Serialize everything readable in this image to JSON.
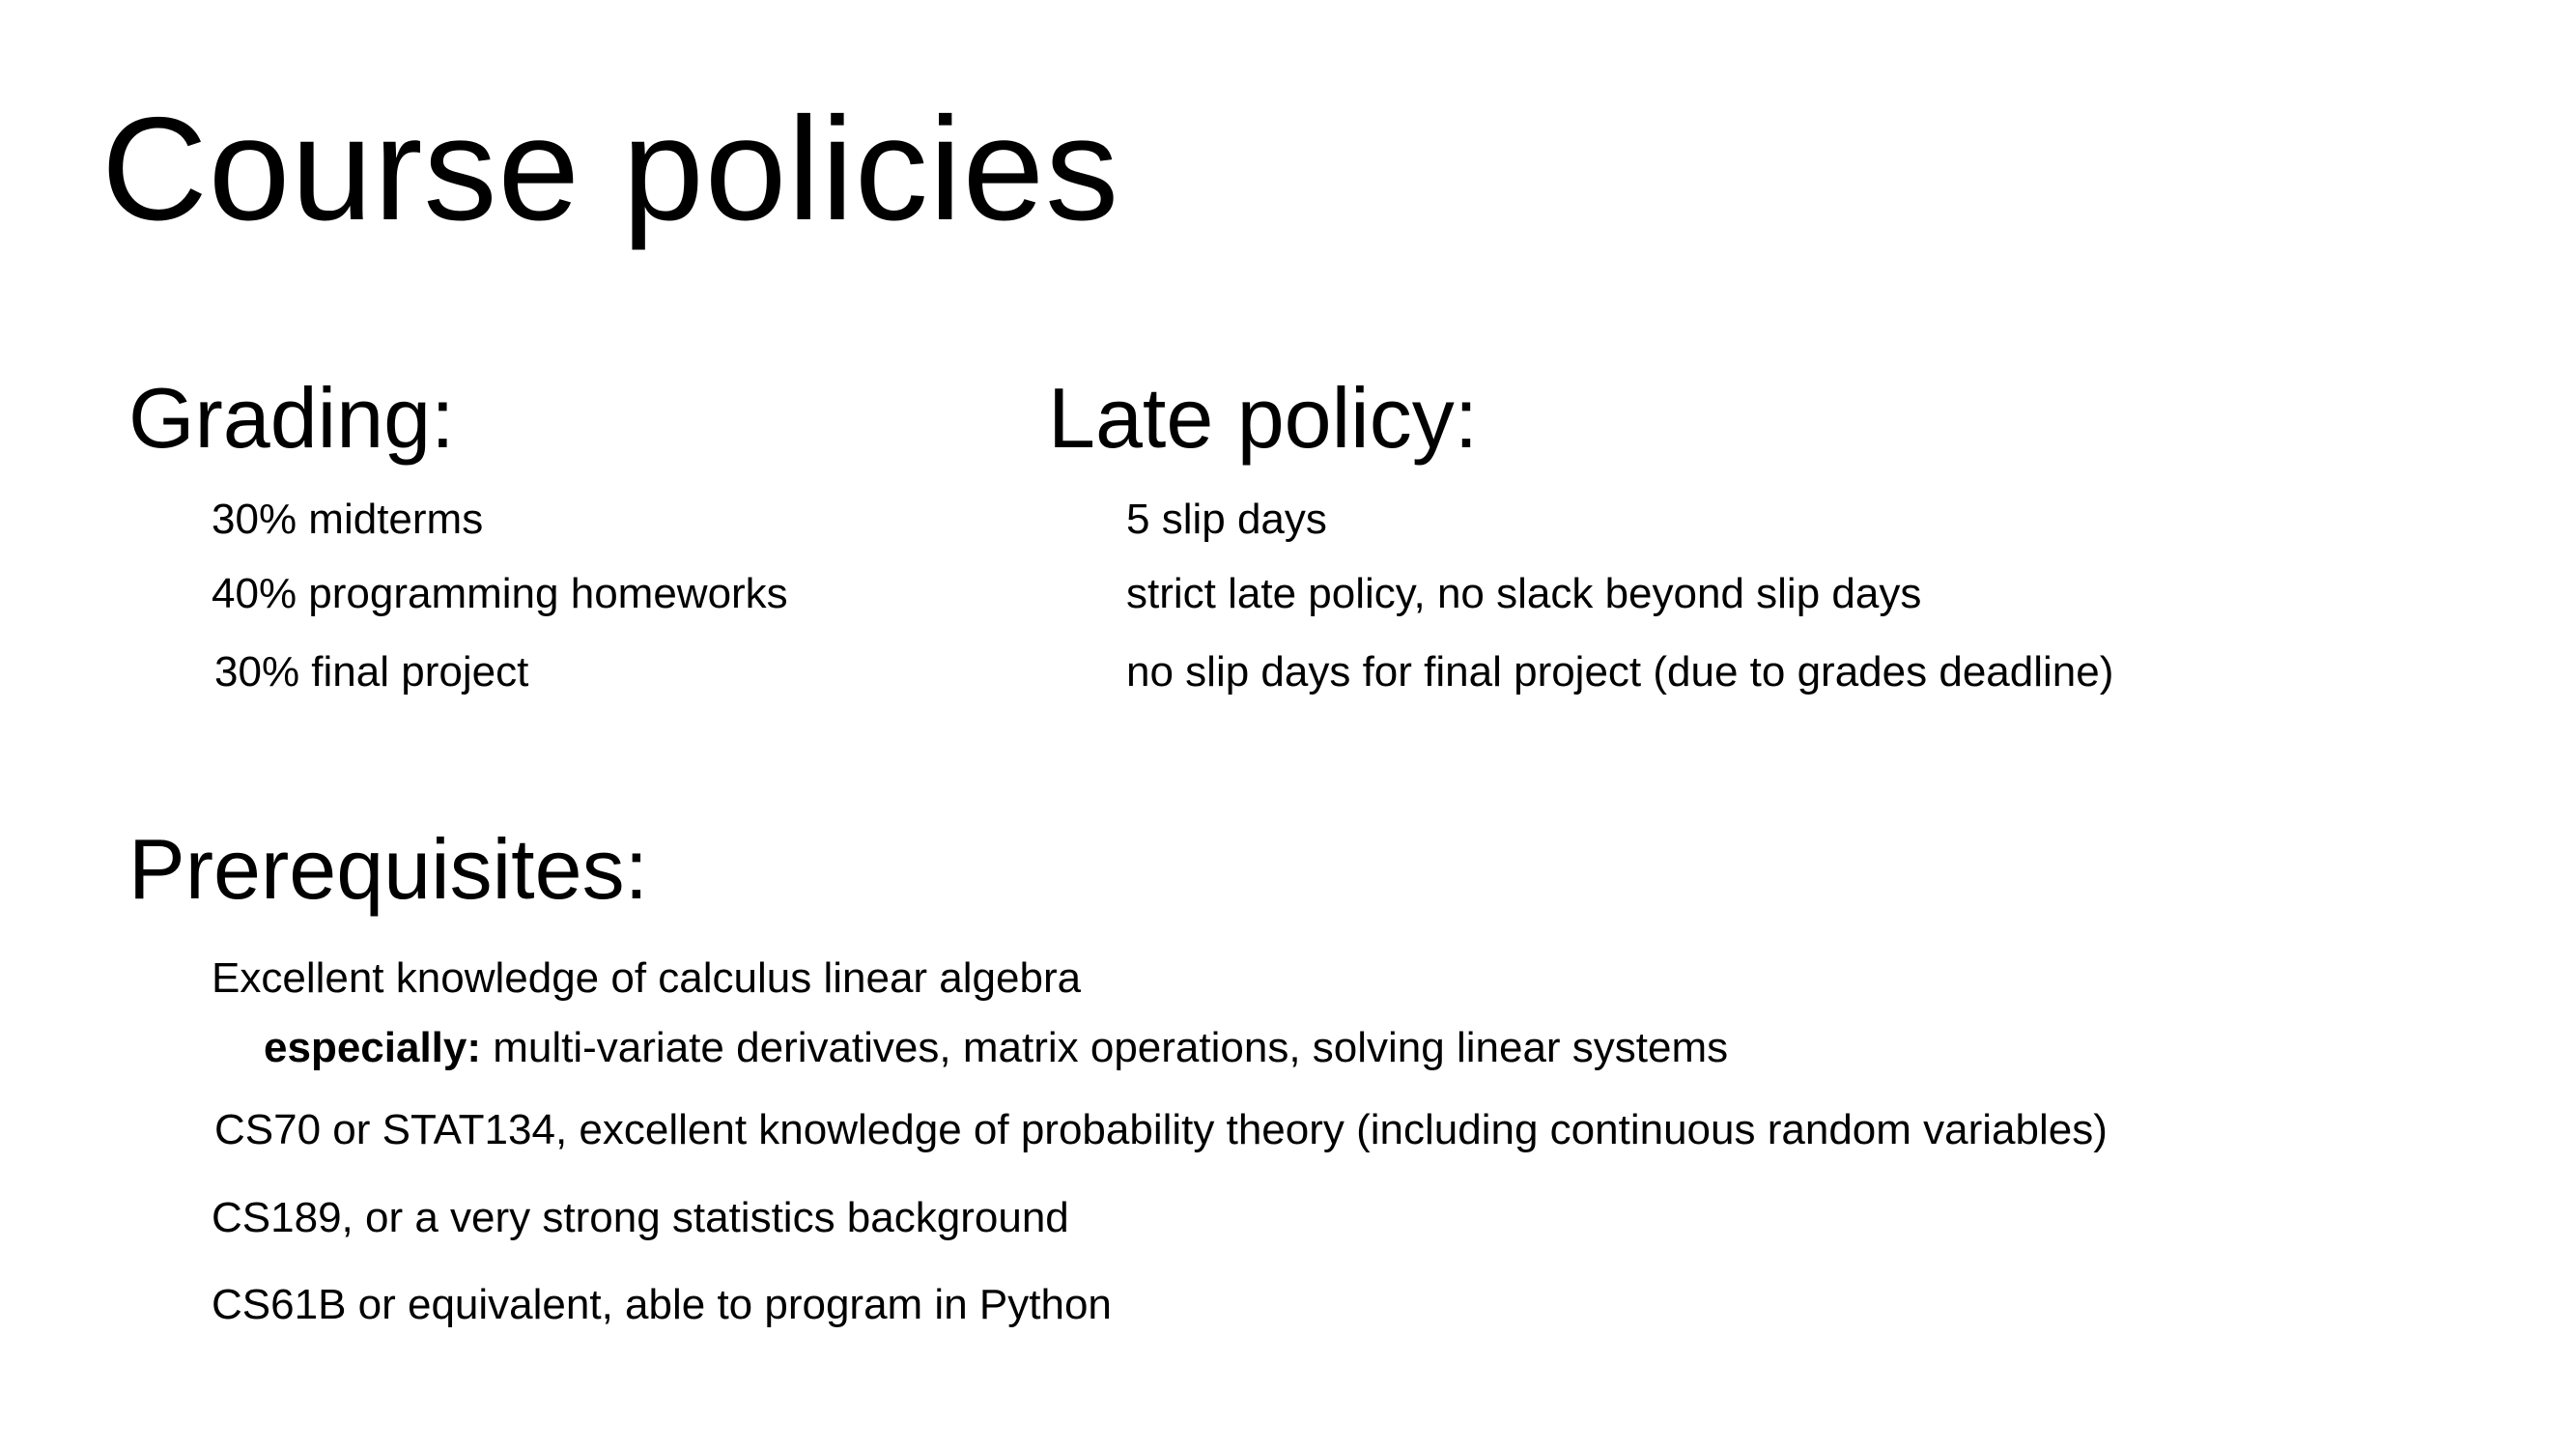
{
  "slide": {
    "title": "Course policies",
    "grading": {
      "heading": "Grading:",
      "items": [
        "30% midterms",
        "40% programming homeworks",
        "30% final project"
      ]
    },
    "late_policy": {
      "heading": "Late policy:",
      "items": [
        "5 slip days",
        "strict late policy, no slack beyond slip days",
        "no slip days for final project (due to grades deadline)"
      ]
    },
    "prerequisites": {
      "heading": "Prerequisites:",
      "items": [
        "Excellent knowledge of calculus linear algebra",
        "CS70 or STAT134, excellent knowledge of probability theory (including continuous random variables)",
        "CS189, or a very strong statistics background",
        "CS61B or equivalent, able to program in Python"
      ],
      "sub_item": {
        "label": "especially:",
        "text": " multi-variate derivatives, matrix operations, solving linear systems"
      }
    }
  }
}
